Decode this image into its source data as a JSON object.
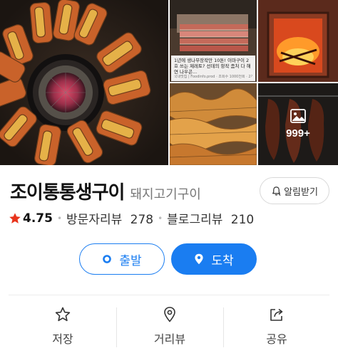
{
  "gallery": {
    "caption": "1년에 생나무장작만 10톤! 이마구이 2호 쓰는 제레토? 선데의 항작 좀처 다 해연 나우곤...",
    "caption_source": "국내맛집 | Foodinfo.prod · 조회수 1000천회 · 2개월 전",
    "more_count": "999+",
    "icons": {
      "more": "image-icon"
    }
  },
  "place": {
    "name": "조이통통생구이",
    "category": "돼지고기구이",
    "alarm_label": "알림받기",
    "alarm_icon": "bell-icon"
  },
  "rating": {
    "star_icon": "star-icon",
    "value": "4.75",
    "visitor_review_label": "방문자리뷰",
    "visitor_review_count": "278",
    "blog_review_label": "블로그리뷰",
    "blog_review_count": "210"
  },
  "route": {
    "start_label": "출발",
    "dest_label": "도착",
    "accent": "#1a7df1"
  },
  "actions": [
    {
      "label": "저장",
      "icon": "star-outline-icon"
    },
    {
      "label": "거리뷰",
      "icon": "map-pin-icon"
    },
    {
      "label": "공유",
      "icon": "share-icon"
    }
  ],
  "colors": {
    "accent": "#1a7df1",
    "star": "#e8341c"
  }
}
